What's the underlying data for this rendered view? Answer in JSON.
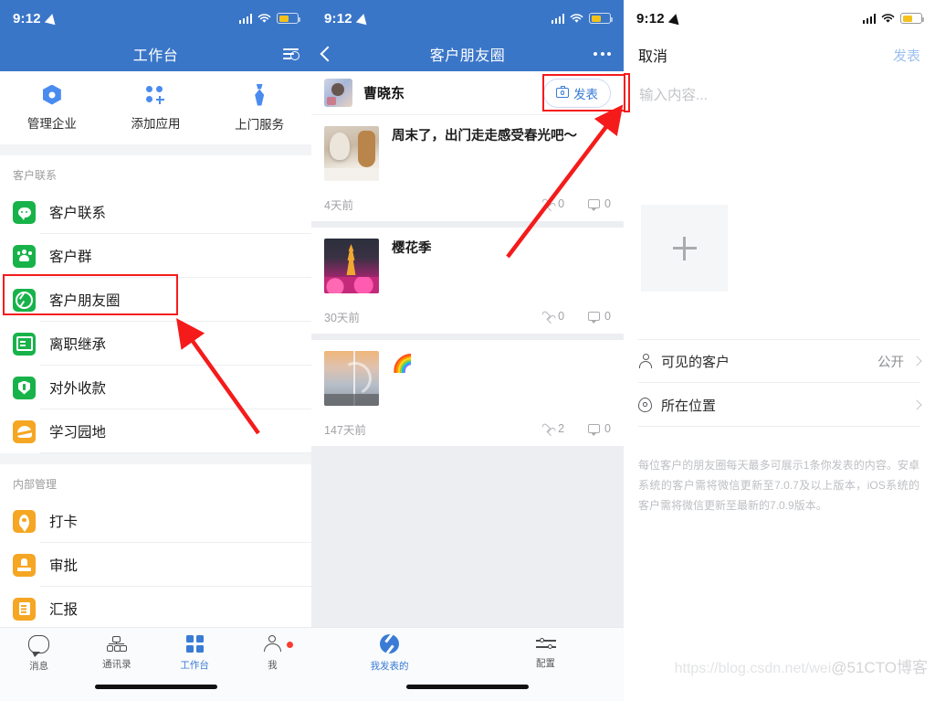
{
  "status_bar": {
    "time": "9:12",
    "location_icon": "location-arrow-icon",
    "signal_icon": "signal-bars-icon",
    "wifi_icon": "wifi-icon",
    "battery_icon": "battery-icon"
  },
  "colors": {
    "header_blue": "#3a76c8",
    "accent_blue": "#3a7bd5",
    "green": "#17b34a",
    "orange": "#f5a623",
    "annotation_red": "#f51b1b"
  },
  "left_panel": {
    "nav": {
      "title": "工作台",
      "settings_icon": "list-settings-icon"
    },
    "quick_actions": [
      {
        "label": "管理企业",
        "icon": "hexagon-icon"
      },
      {
        "label": "添加应用",
        "icon": "add-app-icon"
      },
      {
        "label": "上门服务",
        "icon": "tie-icon"
      }
    ],
    "sections": [
      {
        "title": "客户联系",
        "items": [
          {
            "label": "客户联系",
            "icon": "chat-bubble-icon",
            "color": "green",
            "highlighted": false
          },
          {
            "label": "客户群",
            "icon": "group-icon",
            "color": "green",
            "highlighted": false
          },
          {
            "label": "客户朋友圈",
            "icon": "shutter-icon",
            "color": "green",
            "highlighted": true
          },
          {
            "label": "离职继承",
            "icon": "card-icon",
            "color": "green",
            "highlighted": false
          },
          {
            "label": "对外收款",
            "icon": "shield-icon",
            "color": "green",
            "highlighted": false
          },
          {
            "label": "学习园地",
            "icon": "book-icon",
            "color": "orange",
            "highlighted": false
          }
        ]
      },
      {
        "title": "内部管理",
        "items": [
          {
            "label": "打卡",
            "icon": "pin-icon",
            "color": "orange",
            "highlighted": false
          },
          {
            "label": "审批",
            "icon": "stamp-icon",
            "color": "orange",
            "highlighted": false
          },
          {
            "label": "汇报",
            "icon": "report-icon",
            "color": "orange",
            "highlighted": false
          }
        ]
      }
    ],
    "tabbar": [
      {
        "label": "消息",
        "icon": "message-icon",
        "active": false,
        "badge": false
      },
      {
        "label": "通讯录",
        "icon": "org-chart-icon",
        "active": false,
        "badge": false
      },
      {
        "label": "工作台",
        "icon": "grid-icon",
        "active": true,
        "badge": false
      },
      {
        "label": "我",
        "icon": "person-icon",
        "active": false,
        "badge": true
      }
    ]
  },
  "mid_panel": {
    "nav": {
      "back_icon": "chevron-left-icon",
      "title": "客户朋友圈",
      "more_icon": "more-dots-icon"
    },
    "author": {
      "name": "曹晓东",
      "avatar": "user-avatar"
    },
    "publish_button": {
      "label": "发表",
      "icon": "camera-icon"
    },
    "posts": [
      {
        "text": "周末了，出门走走感受春光吧～",
        "time": "4天前",
        "likes": "0",
        "comments": "0",
        "thumb": "guitar-photo"
      },
      {
        "text": "樱花季",
        "time": "30天前",
        "likes": "0",
        "comments": "0",
        "thumb": "sakura-pagoda-photo"
      },
      {
        "text": "🌈",
        "time": "147天前",
        "likes": "2",
        "comments": "0",
        "thumb": "rainbow-photo"
      }
    ],
    "tabbar": [
      {
        "label": "我发表的",
        "icon": "shutter-icon",
        "active": true
      },
      {
        "label": "配置",
        "icon": "sliders-icon",
        "active": false
      }
    ]
  },
  "right_panel": {
    "nav": {
      "cancel": "取消",
      "post": "发表"
    },
    "content_placeholder": "输入内容...",
    "add_photo": {
      "icon": "plus-icon"
    },
    "options": [
      {
        "label": "可见的客户",
        "icon": "person-icon",
        "value": "公开",
        "chevron": "chevron-right-icon"
      },
      {
        "label": "所在位置",
        "icon": "location-pin-icon",
        "value": "",
        "chevron": "chevron-right-icon"
      }
    ],
    "help_text": "每位客户的朋友圈每天最多可展示1条你发表的内容。安卓系统的客户需将微信更新至7.0.7及以上版本，iOS系统的客户需将微信更新至最新的7.0.9版本。"
  },
  "watermark": {
    "url": "https://blog.csdn.net/wei",
    "tag": "@51CTO博客"
  }
}
